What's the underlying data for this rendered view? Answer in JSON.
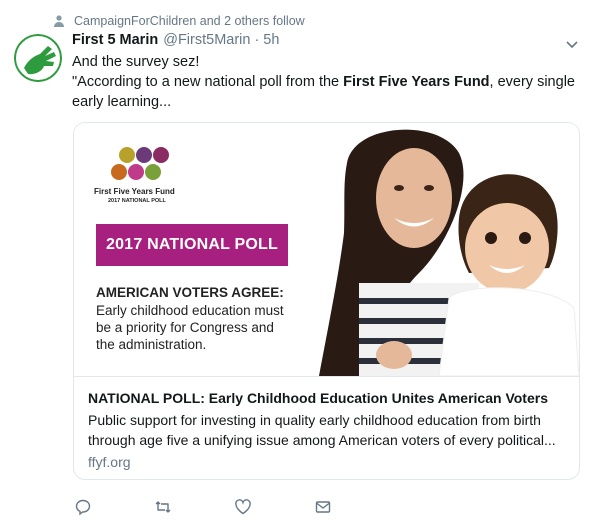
{
  "social_context": {
    "text": "CampaignForChildren and 2 others follow",
    "icon": "person-icon"
  },
  "author": {
    "fullname": "First 5 Marin",
    "username": "@First5Marin",
    "separator": "·",
    "timestamp": "5h",
    "avatar_color": "#2e9b3e"
  },
  "tweet": {
    "line1": "And the survey sez!",
    "line2_prefix": "\"According to a new national poll from the ",
    "line2_bold": "First Five Years Fund",
    "line2_suffix": ", every single",
    "line3": "early learning..."
  },
  "card": {
    "image": {
      "logo_name": "First Five Years Fund",
      "logo_sub": "2017 NATIONAL POLL",
      "banner": "2017 NATIONAL POLL",
      "heading": "AMERICAN VOTERS AGREE:",
      "body_lines": [
        "Early childhood education must",
        "be a priority for Congress and",
        "the administration."
      ],
      "banner_color": "#a8207f",
      "dot_colors": [
        "#b8a12a",
        "#6b3a78",
        "#8a2b63",
        "#c76a1f",
        "#c03a8a",
        "#7aa03a"
      ]
    },
    "title": "NATIONAL POLL: Early Childhood Education Unites American Voters",
    "description_lines": [
      "Public support for investing in quality early childhood education from birth",
      "through age five a unifying issue among American voters of every political..."
    ],
    "domain": "ffyf.org"
  },
  "actions": [
    {
      "name": "reply",
      "icon": "reply-icon"
    },
    {
      "name": "retweet",
      "icon": "retweet-icon"
    },
    {
      "name": "like",
      "icon": "heart-icon"
    },
    {
      "name": "message",
      "icon": "envelope-icon"
    }
  ]
}
